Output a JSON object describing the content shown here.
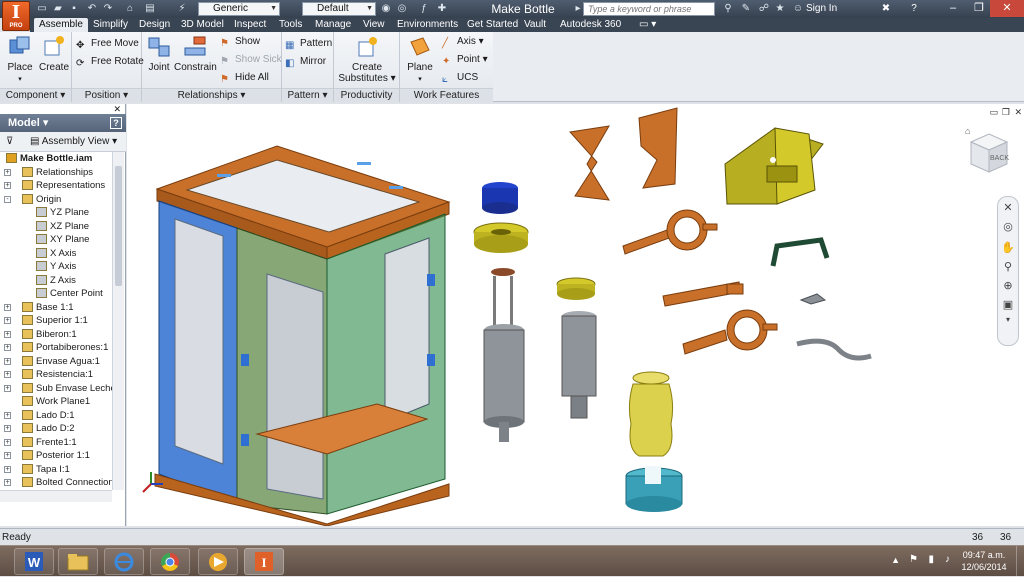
{
  "titlebar": {
    "document_title": "Make Bottle",
    "appearance_combo": "Generic",
    "material_combo": "Default",
    "search_placeholder": "Type a keyword or phrase",
    "sign_in": "Sign In",
    "app_button_letter": "I",
    "app_button_sub": "PRO"
  },
  "tabs": [
    "Assemble",
    "Simplify",
    "Design",
    "3D Model",
    "Inspect",
    "Tools",
    "Manage",
    "View",
    "Environments",
    "Get Started",
    "Vault",
    "Autodesk 360"
  ],
  "ribbon": {
    "component": {
      "label": "Component",
      "place": "Place",
      "create": "Create"
    },
    "position": {
      "label": "Position",
      "free_move": "Free Move",
      "free_rotate": "Free Rotate"
    },
    "relationships": {
      "label": "Relationships",
      "joint": "Joint",
      "constrain": "Constrain",
      "show": "Show",
      "show_sick": "Show Sick",
      "hide_all": "Hide All"
    },
    "pattern": {
      "label": "Pattern",
      "pattern": "Pattern",
      "mirror": "Mirror"
    },
    "productivity": {
      "label": "Productivity",
      "create_substitutes_1": "Create",
      "create_substitutes_2": "Substitutes"
    },
    "work_features": {
      "label": "Work Features",
      "plane": "Plane",
      "axis": "Axis",
      "point": "Point",
      "ucs": "UCS"
    }
  },
  "browser": {
    "title": "Model",
    "view_mode": "Assembly View",
    "nodes": [
      {
        "label": "Make Bottle.iam",
        "level": 0,
        "expander": "",
        "bold": true
      },
      {
        "label": "Relationships",
        "level": 1,
        "expander": "+"
      },
      {
        "label": "Representations",
        "level": 1,
        "expander": "+"
      },
      {
        "label": "Origin",
        "level": 1,
        "expander": "-"
      },
      {
        "label": "YZ Plane",
        "level": 2,
        "expander": ""
      },
      {
        "label": "XZ Plane",
        "level": 2,
        "expander": ""
      },
      {
        "label": "XY Plane",
        "level": 2,
        "expander": ""
      },
      {
        "label": "X Axis",
        "level": 2,
        "expander": ""
      },
      {
        "label": "Y Axis",
        "level": 2,
        "expander": ""
      },
      {
        "label": "Z Axis",
        "level": 2,
        "expander": ""
      },
      {
        "label": "Center Point",
        "level": 2,
        "expander": ""
      },
      {
        "label": "Base 1:1",
        "level": 1,
        "expander": "+"
      },
      {
        "label": "Superior 1:1",
        "level": 1,
        "expander": "+"
      },
      {
        "label": "Biberon:1",
        "level": 1,
        "expander": "+"
      },
      {
        "label": "Portabiberones:1",
        "level": 1,
        "expander": "+"
      },
      {
        "label": "Envase Agua:1",
        "level": 1,
        "expander": "+"
      },
      {
        "label": "Resistencia:1",
        "level": 1,
        "expander": "+"
      },
      {
        "label": "Sub Envase Leche:1",
        "level": 1,
        "expander": "+"
      },
      {
        "label": "Work Plane1",
        "level": 1,
        "expander": ""
      },
      {
        "label": "Lado D:1",
        "level": 1,
        "expander": "+"
      },
      {
        "label": "Lado D:2",
        "level": 1,
        "expander": "+"
      },
      {
        "label": "Frente1:1",
        "level": 1,
        "expander": "+"
      },
      {
        "label": "Posterior 1:1",
        "level": 1,
        "expander": "+"
      },
      {
        "label": "Tapa I:1",
        "level": 1,
        "expander": "+"
      },
      {
        "label": "Bolted Connection:1",
        "level": 1,
        "expander": "+"
      }
    ]
  },
  "viewcube": {
    "face_label": "BACK"
  },
  "status": {
    "text": "Ready",
    "count_a": "36",
    "count_b": "36"
  },
  "taskbar": {
    "time": "09:47 a.m.",
    "date": "12/06/2014"
  },
  "colors": {
    "wood": "#c8702a",
    "blue_panel": "#2e6fd1",
    "green_panel": "#2d8a4a",
    "yellow": "#d4c92a",
    "teal": "#3aa0b8"
  }
}
